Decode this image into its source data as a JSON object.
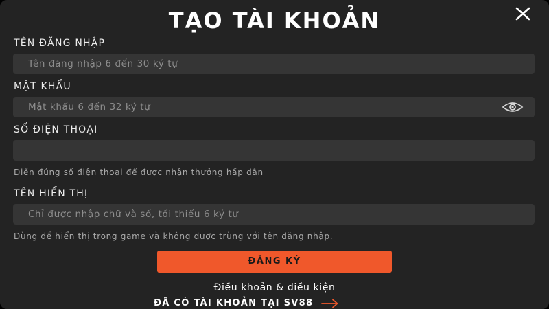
{
  "modal": {
    "title": "TẠO TÀI KHOẢN",
    "close_icon": "close-icon"
  },
  "username": {
    "label": "TÊN ĐĂNG NHẬP",
    "placeholder": "Tên đăng nhập 6 đến 30 ký tự",
    "value": ""
  },
  "password": {
    "label": "MẬT KHẨU",
    "placeholder": "Mật khẩu 6 đến 32 ký tự",
    "value": "",
    "toggle_icon": "eye-icon"
  },
  "phone": {
    "label": "SỐ ĐIỆN THOẠI",
    "placeholder": "",
    "value": "",
    "hint": "Điền đúng số điện thoại để được nhận thưởng hấp dẫn"
  },
  "display_name": {
    "label": "TÊN HIỂN THỊ",
    "placeholder": "Chỉ được nhập chữ và số, tối thiểu 6 ký tự",
    "value": "",
    "hint": "Dùng để hiển thị trong game và không được trùng với tên đăng nhập."
  },
  "actions": {
    "submit_label": "ĐĂNG KÝ",
    "terms_link": "Điều khoản & điều kiện",
    "login_link": "ĐÃ CÓ TÀI KHOẢN TẠI SV88",
    "login_icon": "arrow-right-icon"
  },
  "colors": {
    "background": "#232323",
    "field": "#353535",
    "accent": "#f0582b",
    "text": "#ffffff",
    "placeholder": "#8d8d8d",
    "hint": "#a9a9a9"
  }
}
